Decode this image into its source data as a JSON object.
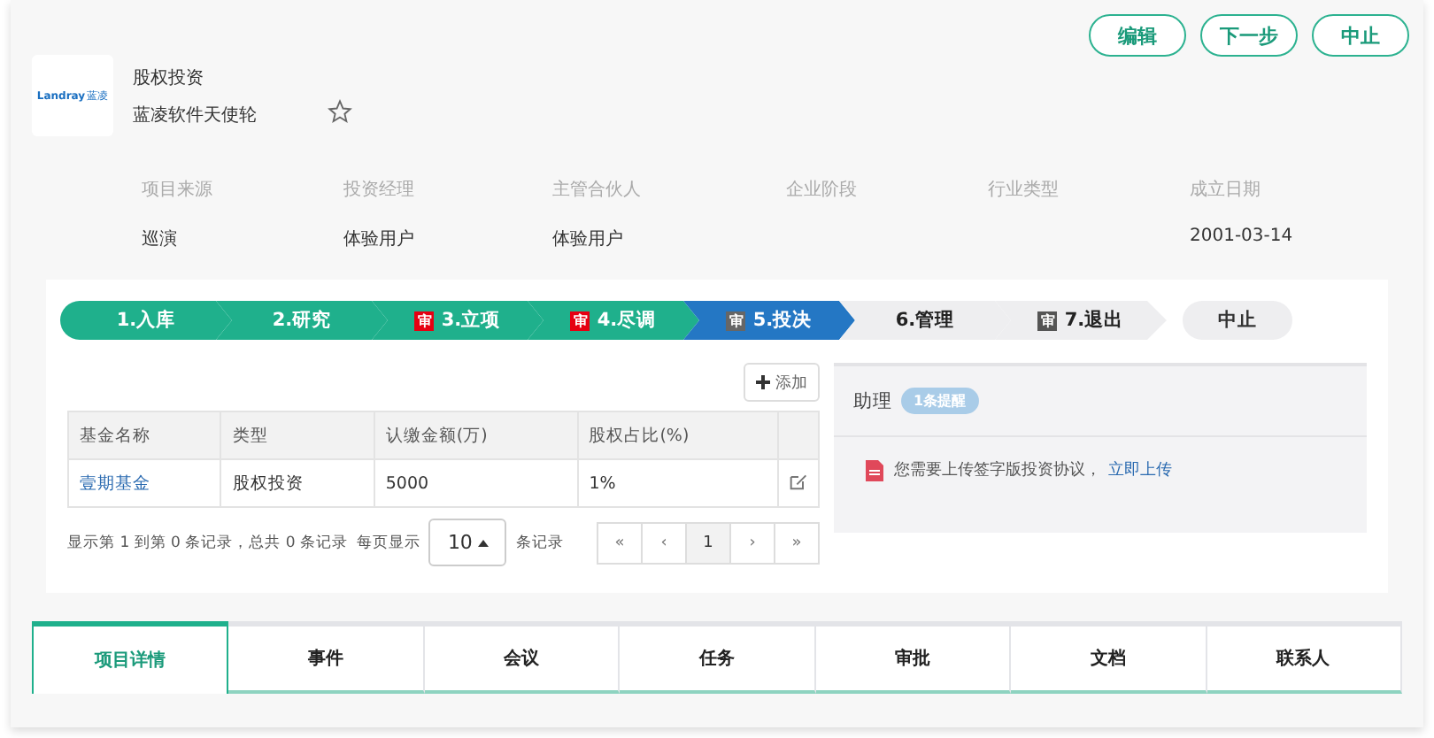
{
  "actions": [
    {
      "label": "编辑"
    },
    {
      "label": "下一步"
    },
    {
      "label": "中止"
    }
  ],
  "project": {
    "logo_text": "Landray",
    "logo_mark": "蓝凌",
    "category": "股权投资",
    "name": "蓝凌软件天使轮",
    "starred": false
  },
  "fields": [
    {
      "label": "项目来源",
      "value": "巡演"
    },
    {
      "label": "投资经理",
      "value": "体验用户"
    },
    {
      "label": "主管合伙人",
      "value": "体验用户"
    },
    {
      "label": "企业阶段"
    },
    {
      "label": "行业类型"
    },
    {
      "label": "成立日期",
      "value": "2001-03-14"
    }
  ],
  "steps": [
    {
      "label": "1.入库",
      "kind": "done"
    },
    {
      "label": "2.研究",
      "kind": "done"
    },
    {
      "label": "3.立项",
      "kind": "done",
      "badge": {
        "label": "审",
        "color": "#e60012"
      }
    },
    {
      "label": "4.尽调",
      "kind": "done",
      "badge": {
        "label": "审",
        "color": "#e60012"
      }
    },
    {
      "label": "5.投决",
      "kind": "current",
      "badge": {
        "label": "审",
        "color": "#666666"
      }
    },
    {
      "label": "6.管理",
      "kind": "pending"
    },
    {
      "label": "7.退出",
      "kind": "pending",
      "badge": {
        "label": "审",
        "color": "#555555"
      }
    }
  ],
  "stop_step": {
    "label": "中止"
  },
  "add_button": {
    "label": "添加"
  },
  "table": {
    "columns": [
      "基金名称",
      "类型",
      "认缴金额(万)",
      "股权占比(%)"
    ],
    "rows": [
      {
        "cells": [
          "壹期基金",
          "股权投资",
          "5000",
          "1%"
        ]
      }
    ]
  },
  "pagination": {
    "summary": "显示第 1 到第 0 条记录，总共 0 条记录",
    "per_page_label": "每页显示",
    "page_size": "10",
    "suffix": "条记录",
    "pages": [
      {
        "label": "«",
        "selected": false
      },
      {
        "label": "‹",
        "selected": false
      },
      {
        "label": "1",
        "selected": true
      },
      {
        "label": "›",
        "selected": false
      },
      {
        "label": "»",
        "selected": false
      }
    ]
  },
  "assistant": {
    "title": "助理",
    "badge": "1条提醒",
    "items": [
      {
        "text": "您需要上传签字版投资协议，",
        "link": "立即上传"
      }
    ]
  },
  "tabs": [
    {
      "label": "项目详情",
      "selected": true
    },
    {
      "label": "事件",
      "selected": false
    },
    {
      "label": "会议",
      "selected": false
    },
    {
      "label": "任务",
      "selected": false
    },
    {
      "label": "审批",
      "selected": false
    },
    {
      "label": "文档",
      "selected": false
    },
    {
      "label": "联系人",
      "selected": false
    }
  ]
}
